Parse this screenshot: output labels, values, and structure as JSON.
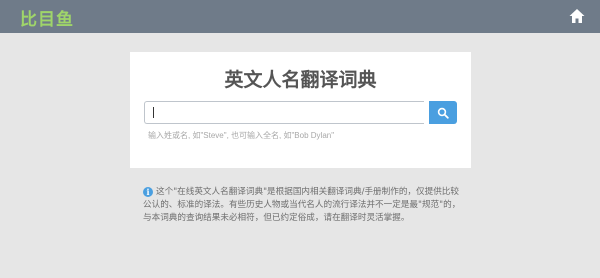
{
  "header": {
    "logo_text": "比目鱼",
    "home_icon": "home-icon",
    "logo_color": "#9fd56a",
    "bar_color": "#6f7b89"
  },
  "card": {
    "title": "英文人名翻译词典",
    "search": {
      "value": "",
      "button_icon": "search-icon",
      "button_color": "#4a9fe0"
    },
    "hint": "输入姓或名, 如\"Steve\", 也可输入全名, 如\"Bob Dylan\""
  },
  "notice": {
    "icon": "info-icon",
    "text": "这个\"在线英文人名翻译词典\"是根据国内相关翻译词典/手册制作的，仅提供比较公认的、标准的译法。有些历史人物或当代名人的流行译法并不一定是最\"规范\"的，与本词典的查询结果未必相符，但已约定俗成，请在翻译时灵活掌握。"
  }
}
